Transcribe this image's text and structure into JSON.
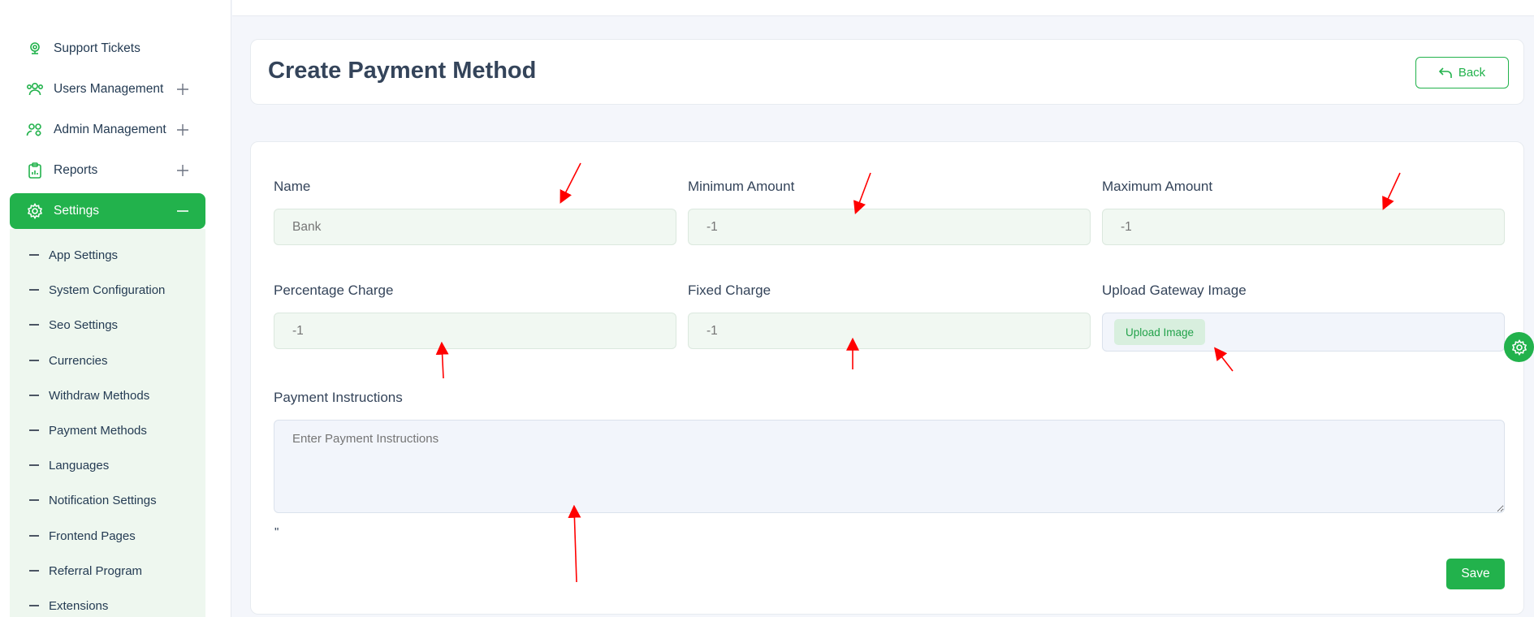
{
  "sidebar": {
    "items": [
      {
        "label": "Support Tickets",
        "icon": "support-icon"
      },
      {
        "label": "Users Management",
        "icon": "users-icon"
      },
      {
        "label": "Admin Management",
        "icon": "admin-icon"
      },
      {
        "label": "Reports",
        "icon": "reports-icon"
      },
      {
        "label": "Settings",
        "icon": "settings-icon"
      }
    ],
    "submenu": [
      "App Settings",
      "System Configuration",
      "Seo Settings",
      "Currencies",
      "Withdraw Methods",
      "Payment Methods",
      "Languages",
      "Notification Settings",
      "Frontend Pages",
      "Referral Program",
      "Extensions"
    ]
  },
  "header": {
    "title": "Create Payment Method",
    "back_label": "Back"
  },
  "form": {
    "name": {
      "label": "Name",
      "placeholder": "Bank"
    },
    "min_amount": {
      "label": "Minimum Amount",
      "placeholder": "-1"
    },
    "max_amount": {
      "label": "Maximum Amount",
      "placeholder": "-1"
    },
    "percentage_charge": {
      "label": "Percentage Charge",
      "placeholder": "-1"
    },
    "fixed_charge": {
      "label": "Fixed Charge",
      "placeholder": "-1"
    },
    "upload": {
      "label": "Upload Gateway Image",
      "button": "Upload Image"
    },
    "instructions": {
      "label": "Payment Instructions",
      "placeholder": "Enter Payment Instructions"
    },
    "stray_text": "\"",
    "save_label": "Save"
  },
  "colors": {
    "accent": "#22b24c",
    "annotation": "#ff0000"
  }
}
